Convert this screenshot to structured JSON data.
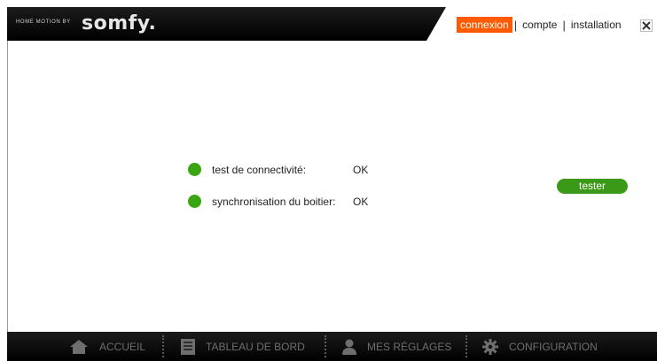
{
  "brand": {
    "tagline": "HOME MOTION BY",
    "logo": "somfy."
  },
  "header": {
    "tabs": [
      {
        "label": "connexion",
        "active": true
      },
      {
        "label": "compte",
        "active": false
      },
      {
        "label": "installation",
        "active": false
      }
    ],
    "separator": "|",
    "close_icon": "close-x-icon"
  },
  "connectivity": {
    "rows": [
      {
        "label": "test de connectivité:",
        "value": "OK",
        "status_color": "#3aa512"
      },
      {
        "label": "synchronisation du boitier:",
        "value": "OK",
        "status_color": "#3aa512"
      }
    ],
    "test_button_label": "tester"
  },
  "footer": {
    "nav": [
      {
        "label": "ACCUEIL",
        "icon": "home-icon"
      },
      {
        "label": "TABLEAU DE BORD",
        "icon": "dashboard-icon"
      },
      {
        "label": "MES RÉGLAGES",
        "icon": "user-icon"
      },
      {
        "label": "CONFIGURATION",
        "icon": "gear-icon",
        "active": true
      }
    ]
  },
  "colors": {
    "accent": "#ff5a00",
    "ok_green": "#3aa512",
    "bar_dark": "#000000"
  }
}
